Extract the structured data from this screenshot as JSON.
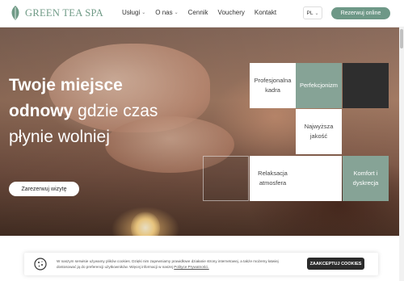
{
  "header": {
    "logo_text": "GREEN TEA SPA",
    "nav": [
      {
        "label": "Usługi",
        "dropdown": true
      },
      {
        "label": "O nas",
        "dropdown": true
      },
      {
        "label": "Cennik",
        "dropdown": false
      },
      {
        "label": "Vouchery",
        "dropdown": false
      },
      {
        "label": "Kontakt",
        "dropdown": false
      }
    ],
    "lang": "PL",
    "book_button": "Rezerwuj online"
  },
  "hero": {
    "title_bold1": "Twoje miejsce",
    "title_bold2": "odnowy",
    "title_rest2": " gdzie czas",
    "title_line3": "płynie wolniej",
    "button": "Zarezerwuj wizytę"
  },
  "tiles": {
    "t1": "Profesjonalna kadra",
    "t2": "Perfekcjonizm",
    "t3": "Najwyższa jakość",
    "t4": "Relaksacja atmosfera",
    "t5": "Komfort i dyskrecja"
  },
  "cookie": {
    "text": "W naszym serwisie używamy plików cookies. Dzięki nim zapewniamy prawidłowe działanie strony internetowej, a także możemy łatwiej dostosować ją do preferencji użytkowników. Więcej informacji w naszej",
    "link": "Polityce Prywatności.",
    "button": "ZAAKCEPTUJ COOKIES"
  },
  "colors": {
    "accent": "#6e9887",
    "sage_tile": "#86a396",
    "dark_tile": "#2e2e2e"
  }
}
